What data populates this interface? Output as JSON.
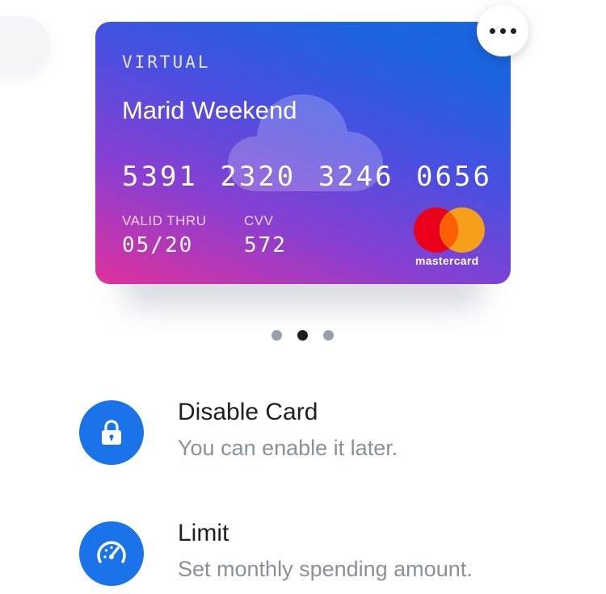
{
  "card": {
    "type_label": "VIRTUAL",
    "holder_name": "Marid Weekend",
    "number": "5391 2320 3246 0656",
    "valid_thru_label": "VALID THRU",
    "valid_thru_value": "05/20",
    "cvv_label": "CVV",
    "cvv_value": "572",
    "brand": "mastercard",
    "gradient_colors": [
      "#e0319c",
      "#8a3fd0",
      "#4a4fe0",
      "#1a66de"
    ]
  },
  "pager": {
    "count": 3,
    "active_index": 1
  },
  "actions": [
    {
      "icon": "lock-icon",
      "title": "Disable Card",
      "subtitle": "You can enable it later."
    },
    {
      "icon": "speedometer-icon",
      "title": "Limit",
      "subtitle": "Set monthly spending amount."
    }
  ],
  "colors": {
    "accent": "#1a73e8",
    "title_text": "#1b1f24",
    "subtitle_text": "#8a9099",
    "mc_red": "#eb001b",
    "mc_orange": "#f79e1b"
  }
}
